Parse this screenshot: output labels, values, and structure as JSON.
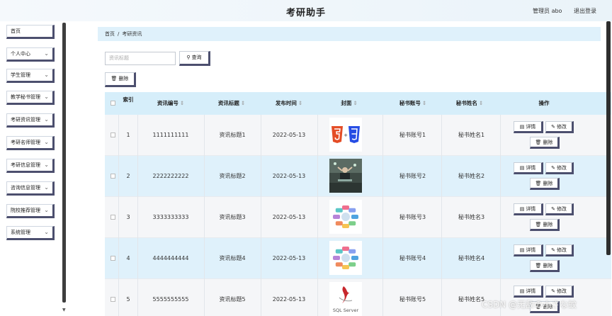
{
  "header": {
    "title": "考研助手",
    "admin": "管理员 abo",
    "logout": "退出登录"
  },
  "sidebar": [
    {
      "label": "首页",
      "chevron": false
    },
    {
      "label": "个人中心",
      "chevron": true
    },
    {
      "label": "学生管理",
      "chevron": true
    },
    {
      "label": "教学秘书管理",
      "chevron": true
    },
    {
      "label": "考研资讯管理",
      "chevron": true
    },
    {
      "label": "考研名师管理",
      "chevron": true
    },
    {
      "label": "考研信息管理",
      "chevron": true
    },
    {
      "label": "咨询信息管理",
      "chevron": true
    },
    {
      "label": "院校推荐管理",
      "chevron": true
    },
    {
      "label": "系统管理",
      "chevron": true
    }
  ],
  "breadcrumb": {
    "home": "首页",
    "sep": "/",
    "current": "考研资讯"
  },
  "search": {
    "placeholder": "资讯标题",
    "button": "查询"
  },
  "toolbar": {
    "delete": "删除"
  },
  "table": {
    "headers": {
      "index": "索引",
      "code": "资讯编号",
      "title": "资讯标题",
      "time": "发布时间",
      "cover": "封面",
      "account": "秘书账号",
      "name": "秘书姓名",
      "ops": "操作"
    },
    "rows": [
      {
        "index": "1",
        "code": "1111111111",
        "title": "资讯标题1",
        "time": "2022-05-13",
        "cover": "html5-css3-logo",
        "account": "秘书账号1",
        "name": "秘书姓名1"
      },
      {
        "index": "2",
        "code": "2222222222",
        "title": "资讯标题2",
        "time": "2022-05-13",
        "cover": "person-at-laptop-photo",
        "account": "秘书账号2",
        "name": "秘书姓名2"
      },
      {
        "index": "3",
        "code": "3333333333",
        "title": "资讯标题3",
        "time": "2022-05-13",
        "cover": "colorful-wheel-diagram",
        "account": "秘书账号3",
        "name": "秘书姓名3"
      },
      {
        "index": "4",
        "code": "4444444444",
        "title": "资讯标题4",
        "time": "2022-05-13",
        "cover": "colorful-wheel-diagram",
        "account": "秘书账号4",
        "name": "秘书姓名4"
      },
      {
        "index": "5",
        "code": "5555555555",
        "title": "资讯标题5",
        "time": "2022-05-13",
        "cover": "sql-server-logo",
        "account": "秘书账号5",
        "name": "秘书姓名5"
      }
    ],
    "actions": {
      "detail": "详情",
      "edit": "修改",
      "delete": "删除"
    }
  },
  "cover_text": {
    "sql": "SQL Server"
  },
  "watermark": "CSDN @无敌の小さな蚊"
}
